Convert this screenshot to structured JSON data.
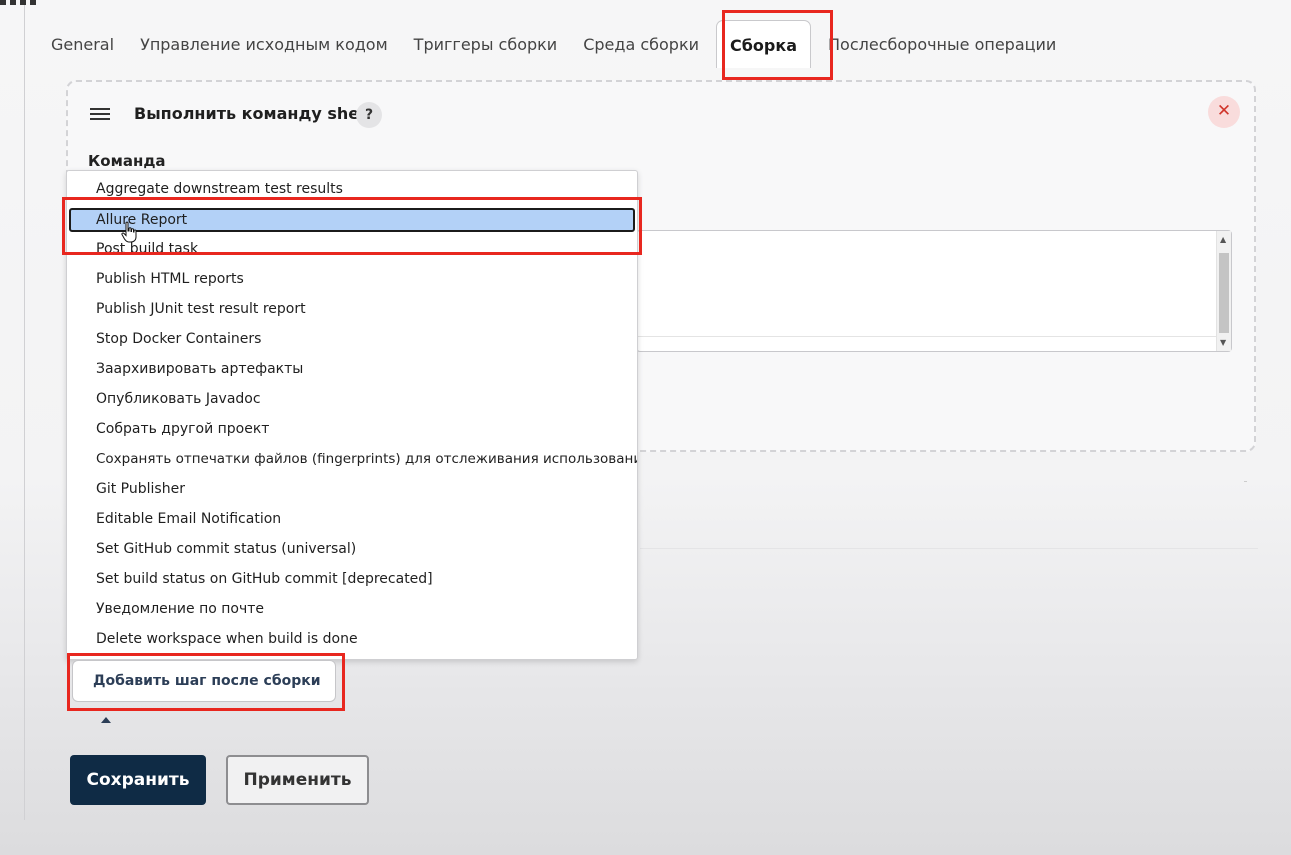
{
  "tabs": [
    {
      "label": "General"
    },
    {
      "label": "Управление исходным кодом"
    },
    {
      "label": "Триггеры сборки"
    },
    {
      "label": "Среда сборки"
    },
    {
      "label": "Сборка"
    },
    {
      "label": "Послесборочные операции"
    }
  ],
  "active_tab": "Сборка",
  "build_step": {
    "title": "Выполнить команду shell",
    "help": "?",
    "close": "✕",
    "field_label": "Команда"
  },
  "dropdown": {
    "items": [
      {
        "label": "Aggregate downstream test results"
      },
      {
        "label": "Allure Report"
      },
      {
        "label": "Post build task"
      },
      {
        "label": "Publish HTML reports"
      },
      {
        "label": "Publish JUnit test result report"
      },
      {
        "label": "Stop Docker Containers"
      },
      {
        "label": "Заархивировать артефакты"
      },
      {
        "label": "Опубликовать Javadoc"
      },
      {
        "label": "Собрать другой проект"
      },
      {
        "label": "Сохранять отпечатки файлов (fingerprints) для отслеживания использования"
      },
      {
        "label": "Git Publisher"
      },
      {
        "label": "Editable Email Notification"
      },
      {
        "label": "Set GitHub commit status (universal)"
      },
      {
        "label": "Set build status on GitHub commit [deprecated]"
      },
      {
        "label": "Уведомление по почте"
      },
      {
        "label": "Delete workspace when build is done"
      }
    ],
    "selected": "Allure Report"
  },
  "add_step_button": "Добавить шаг после сборки",
  "save_button": "Сохранить",
  "apply_button": "Применить",
  "highlight_color": "#e8271f",
  "selection_color": "#b3d1f7"
}
